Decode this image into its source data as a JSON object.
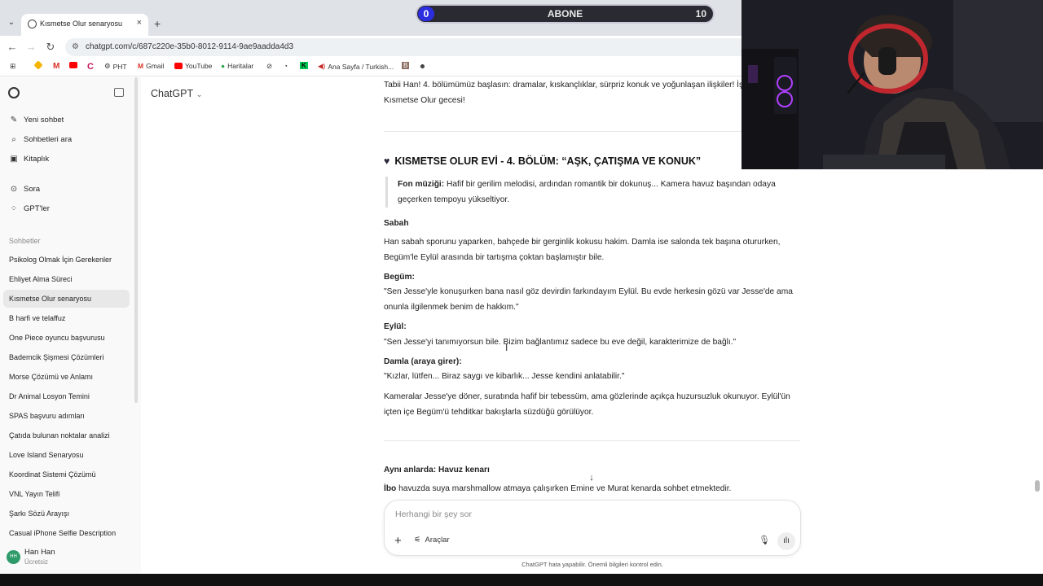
{
  "browser": {
    "tab_title": "Kısmetse Olur senaryosu",
    "new_tab": "+",
    "tab_close": "×",
    "url": "chatgpt.com/c/687c220e-35b0-8012-9114-9ae9aadda4d3"
  },
  "bookmarks": [
    {
      "label": "",
      "icon": "apps-grid-icon"
    },
    {
      "label": "",
      "icon": "drive-icon",
      "color": "#f4b400"
    },
    {
      "label": "",
      "icon": "gmail-icon",
      "color": "#d93025"
    },
    {
      "label": "",
      "icon": "youtube-icon",
      "color": "#ff0000"
    },
    {
      "label": "",
      "icon": "chrome-icon",
      "color": "#c2185b"
    },
    {
      "label": "PHT",
      "icon": "pht-icon"
    },
    {
      "label": "Gmail",
      "icon": "gmail-icon",
      "color": "#d93025"
    },
    {
      "label": "YouTube",
      "icon": "youtube-icon",
      "color": "#ff0000"
    },
    {
      "label": "Haritalar",
      "icon": "maps-icon",
      "color": "#34a853"
    },
    {
      "label": "",
      "icon": "bookmark-icon"
    },
    {
      "label": "",
      "icon": "clock-icon"
    },
    {
      "label": "",
      "icon": "k-icon",
      "color": "#00c853"
    },
    {
      "label": "Ana Sayfa / Turkish...",
      "icon": "speaker-icon",
      "color": "#c62828"
    },
    {
      "label": "",
      "icon": "b-icon",
      "color": "#8d6e63"
    },
    {
      "label": "",
      "icon": "person-icon"
    }
  ],
  "sidebar": {
    "nav": [
      {
        "label": "Yeni sohbet",
        "icon": "edit-icon"
      },
      {
        "label": "Sohbetleri ara",
        "icon": "search-icon"
      },
      {
        "label": "Kitaplık",
        "icon": "library-icon"
      },
      {
        "label": "Sora",
        "icon": "play-circle-icon"
      },
      {
        "label": "GPT'ler",
        "icon": "grid-icon"
      }
    ],
    "heading": "Sohbetler",
    "chats": [
      "Psikolog Olmak İçin Gerekenler",
      "Ehliyet Alma Süreci",
      "Kısmetse Olur senaryosu",
      "B harfi ve telaffuz",
      "One Piece oyuncu başvurusu",
      "Bademcik Şişmesi Çözümleri",
      "Morse Çözümü ve Anlamı",
      "Dr Animal Losyon Temini",
      "SPAS başvuru adımları",
      "Çatıda bulunan noktalar analizi",
      "Love Island Senaryosu",
      "Koordinat Sistemi Çözümü",
      "VNL Yayın Telifi",
      "Şarkı Sözü Arayışı",
      "Casual iPhone Selfie Description"
    ],
    "active_index": 2,
    "user": {
      "initials": "HH",
      "name": "Han Han",
      "plan": "Ücretsiz"
    }
  },
  "header": {
    "model": "ChatGPT",
    "model_chevron": "⌄"
  },
  "message": {
    "intro": "Tabii Han! 4. bölümümüz başlasın: dramalar, kıskançlıklar, sürpriz konuk ve yoğunlaşan ilişkiler! İşte yepyeni bir Kısmetse Olur gecesi!",
    "heading": "KISMETSE OLUR EVİ - 4. BÖLÜM: “AŞK, ÇATIŞMA VE KONUK”",
    "quote_label": "Fon müziği:",
    "quote_text": " Hafif bir gerilim melodisi, ardından romantik bir dokunuş... Kamera havuz başından odaya geçerken tempoyu yükseltiyor.",
    "scene1_title": "Sabah",
    "scene1_text": "Han sabah sporunu yaparken, bahçede bir gerginlik kokusu hakim. Damla ise salonda tek başına otururken, Begüm'le Eylül arasında bir tartışma çoktan başlamıştır bile.",
    "speaker1": "Begüm:",
    "line1": "\"Sen Jesse'yle konuşurken bana nasıl göz devirdin farkındayım Eylül. Bu evde herkesin gözü var Jesse'de ama onunla ilgilenmek benim de hakkım.\"",
    "speaker2": "Eylül:",
    "line2": "\"Sen Jesse'yi tanımıyorsun bile. Bizim bağlantımız sadece bu eve değil, karakterimize de bağlı.\"",
    "speaker3": "Damla (araya girer):",
    "line3": "\"Kızlar, lütfen... Biraz saygı ve kibarlık... Jesse kendini anlatabilir.\"",
    "narration": "Kameralar Jesse'ye döner, suratında hafif bir tebessüm, ama gözlerinde açıkça huzursuzluk okunuyor. Eylül'ün içten içe Begüm'ü tehditkar bakışlarla süzdüğü görülüyor.",
    "scene2_title": "Aynı anlarda: Havuz kenarı",
    "scene2_name": "İbo",
    "scene2_text": " havuzda suya marshmallow atmaya çalışırken Emine ve Murat kenarda sohbet etmektedir."
  },
  "composer": {
    "placeholder": "Herhangi bir şey sor",
    "tools_label": "Araçlar",
    "footer": "ChatGPT hata yapabilir. Önemli bilgileri kontrol edin."
  },
  "overlay": {
    "subscriber_label": "ABONE",
    "subscriber_count": "0",
    "subscriber_goal": "10",
    "bar_color": "#2d2de0"
  }
}
